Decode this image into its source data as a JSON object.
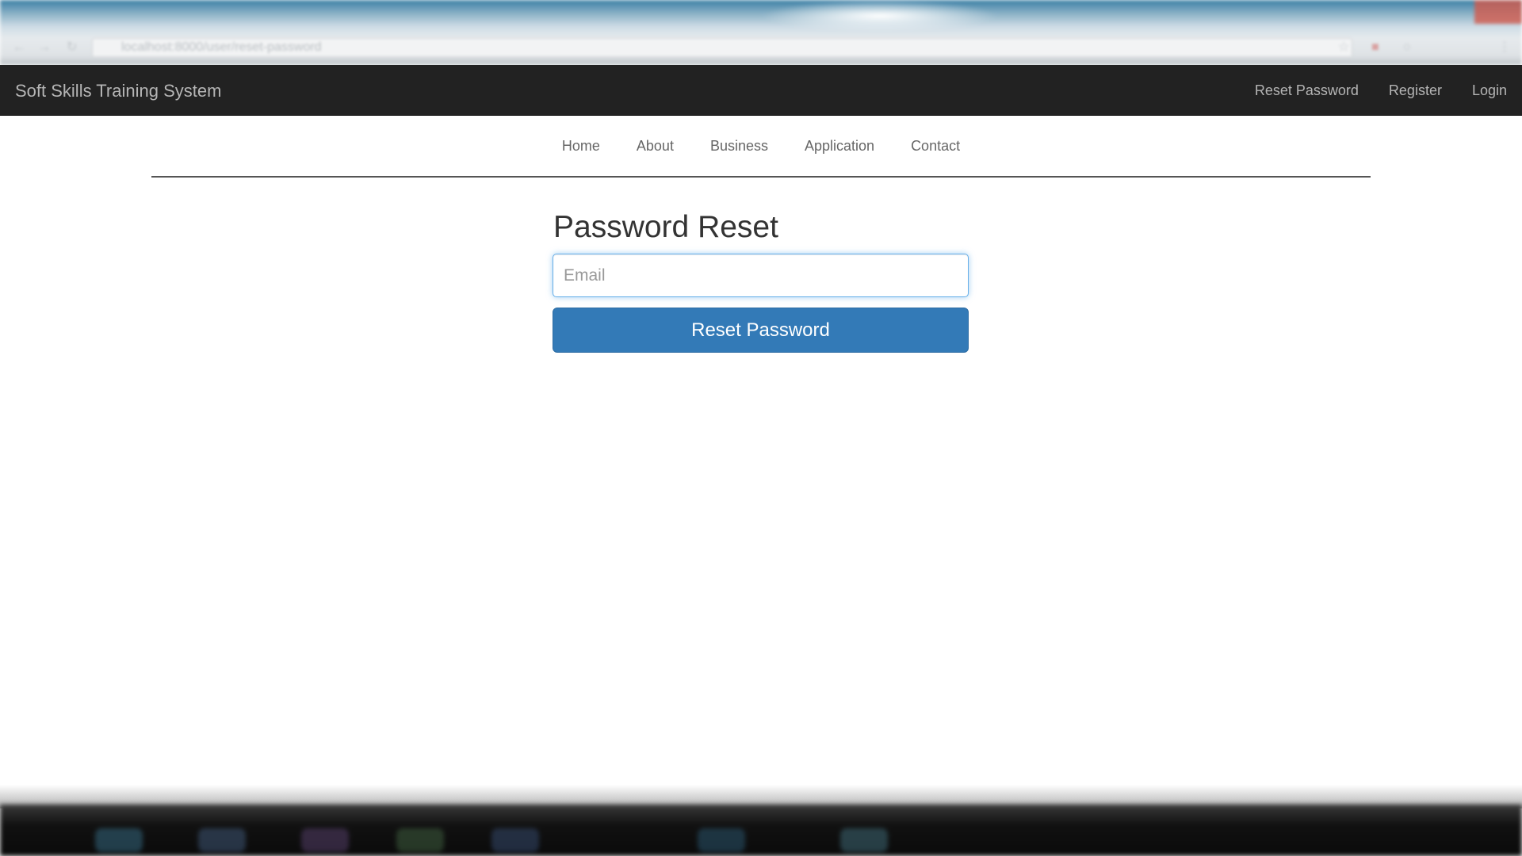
{
  "browser": {
    "url": "localhost:8000/user/reset-password"
  },
  "navbar": {
    "brand": "Soft Skills Training System",
    "links": [
      "Reset Password",
      "Register",
      "Login"
    ]
  },
  "subnav": {
    "links": [
      "Home",
      "About",
      "Business",
      "Application",
      "Contact"
    ]
  },
  "form": {
    "title": "Password Reset",
    "email_placeholder": "Email",
    "email_value": "",
    "submit_label": "Reset Password"
  },
  "colors": {
    "navbar_bg": "#222222",
    "button_primary": "#337ab7",
    "focus_border": "#66afe9"
  }
}
